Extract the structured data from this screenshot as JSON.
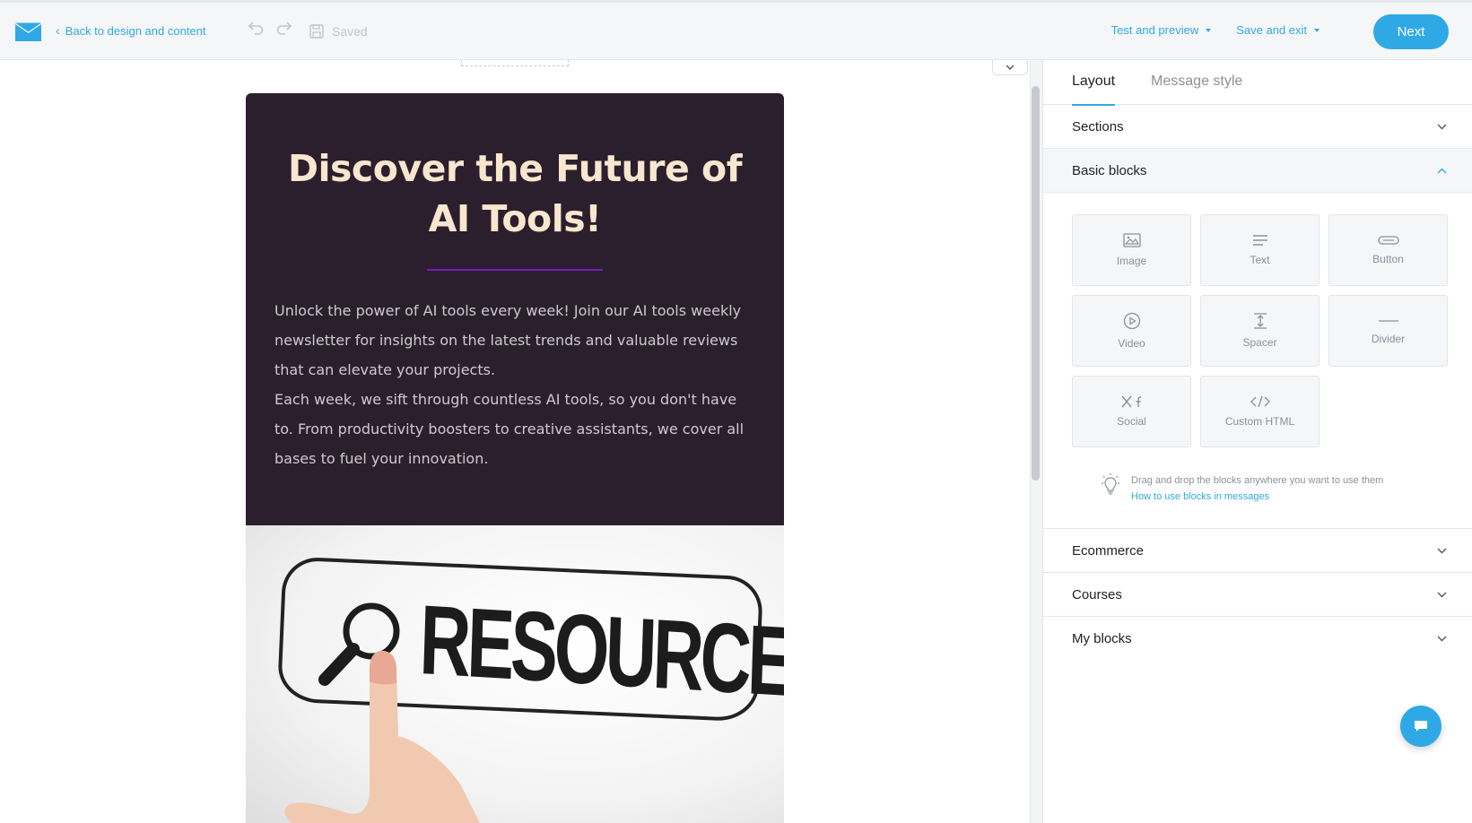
{
  "topbar": {
    "back_label": "Back to design and content",
    "saved_label": "Saved",
    "test_preview_label": "Test and preview",
    "save_exit_label": "Save and exit",
    "next_label": "Next",
    "accent_color": "#2fa9e5"
  },
  "email": {
    "headline": "Discover the Future of AI Tools!",
    "body_p1": "Unlock the power of AI tools every week! Join our AI tools weekly newsletter for insights on the latest trends and valuable reviews that can elevate your projects.",
    "body_p2": "Each week, we sift through countless AI tools, so you don't have to. From productivity boosters to creative assistants, we cover all bases to fuel your innovation.",
    "image_text": "RESOURCES",
    "hero_bg": "#2b1f2d",
    "headline_color": "#f9e6cf"
  },
  "panel": {
    "tabs": [
      {
        "label": "Layout"
      },
      {
        "label": "Message style"
      }
    ],
    "sections_label": "Sections",
    "basic_blocks_label": "Basic blocks",
    "blocks": [
      {
        "label": "Image",
        "icon": "image-icon"
      },
      {
        "label": "Text",
        "icon": "text-icon"
      },
      {
        "label": "Button",
        "icon": "button-icon"
      },
      {
        "label": "Video",
        "icon": "video-icon"
      },
      {
        "label": "Spacer",
        "icon": "spacer-icon"
      },
      {
        "label": "Divider",
        "icon": "divider-icon"
      },
      {
        "label": "Social",
        "icon": "social-icon"
      },
      {
        "label": "Custom HTML",
        "icon": "code-icon"
      }
    ],
    "hint_text": "Drag and drop the blocks anywhere you want to use them",
    "hint_link": "How to use blocks in messages",
    "ecommerce_label": "Ecommerce",
    "courses_label": "Courses",
    "my_blocks_label": "My blocks"
  }
}
